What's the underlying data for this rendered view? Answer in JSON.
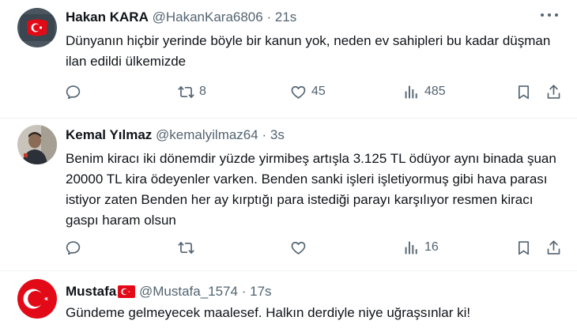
{
  "tweets": [
    {
      "name": "Hakan KARA",
      "handle": "@HakanKara6806",
      "separator": "·",
      "time": "21s",
      "text": "Dünyanın hiçbir yerinde böyle bir kanun yok, neden ev sahipleri bu kadar düşman ilan edildi ülkemizde",
      "replies": "",
      "retweets": "8",
      "likes": "45",
      "views": "485"
    },
    {
      "name": "Kemal Yılmaz",
      "handle": "@kemalyilmaz64",
      "separator": "·",
      "time": "3s",
      "text": "Benim kiracı iki dönemdir yüzde yirmibeş artışla 3.125 TL ödüyor aynı binada şuan 20000 TL kira ödeyenler varken. Benden sanki işleri işletiyormuş gibi hava parası istiyor zaten Benden her ay kırptığı para istediği parayı karşılıyor resmen kiracı gaspı haram olsun",
      "replies": "",
      "retweets": "",
      "likes": "",
      "views": "16"
    },
    {
      "name": "Mustafa",
      "handle": "@Mustafa_1574",
      "separator": "·",
      "time": "17s",
      "text": "Gündeme gelmeyecek maalesef. Halkın derdiyle niye uğraşsınlar ki!"
    }
  ],
  "colors": {
    "text_primary": "#0f1419",
    "text_secondary": "#536471",
    "divider": "#eff3f4",
    "flag_red": "#e30a17"
  },
  "icons": [
    "reply-icon",
    "retweet-icon",
    "like-icon",
    "views-icon",
    "bookmark-icon",
    "share-icon",
    "more-icon"
  ]
}
